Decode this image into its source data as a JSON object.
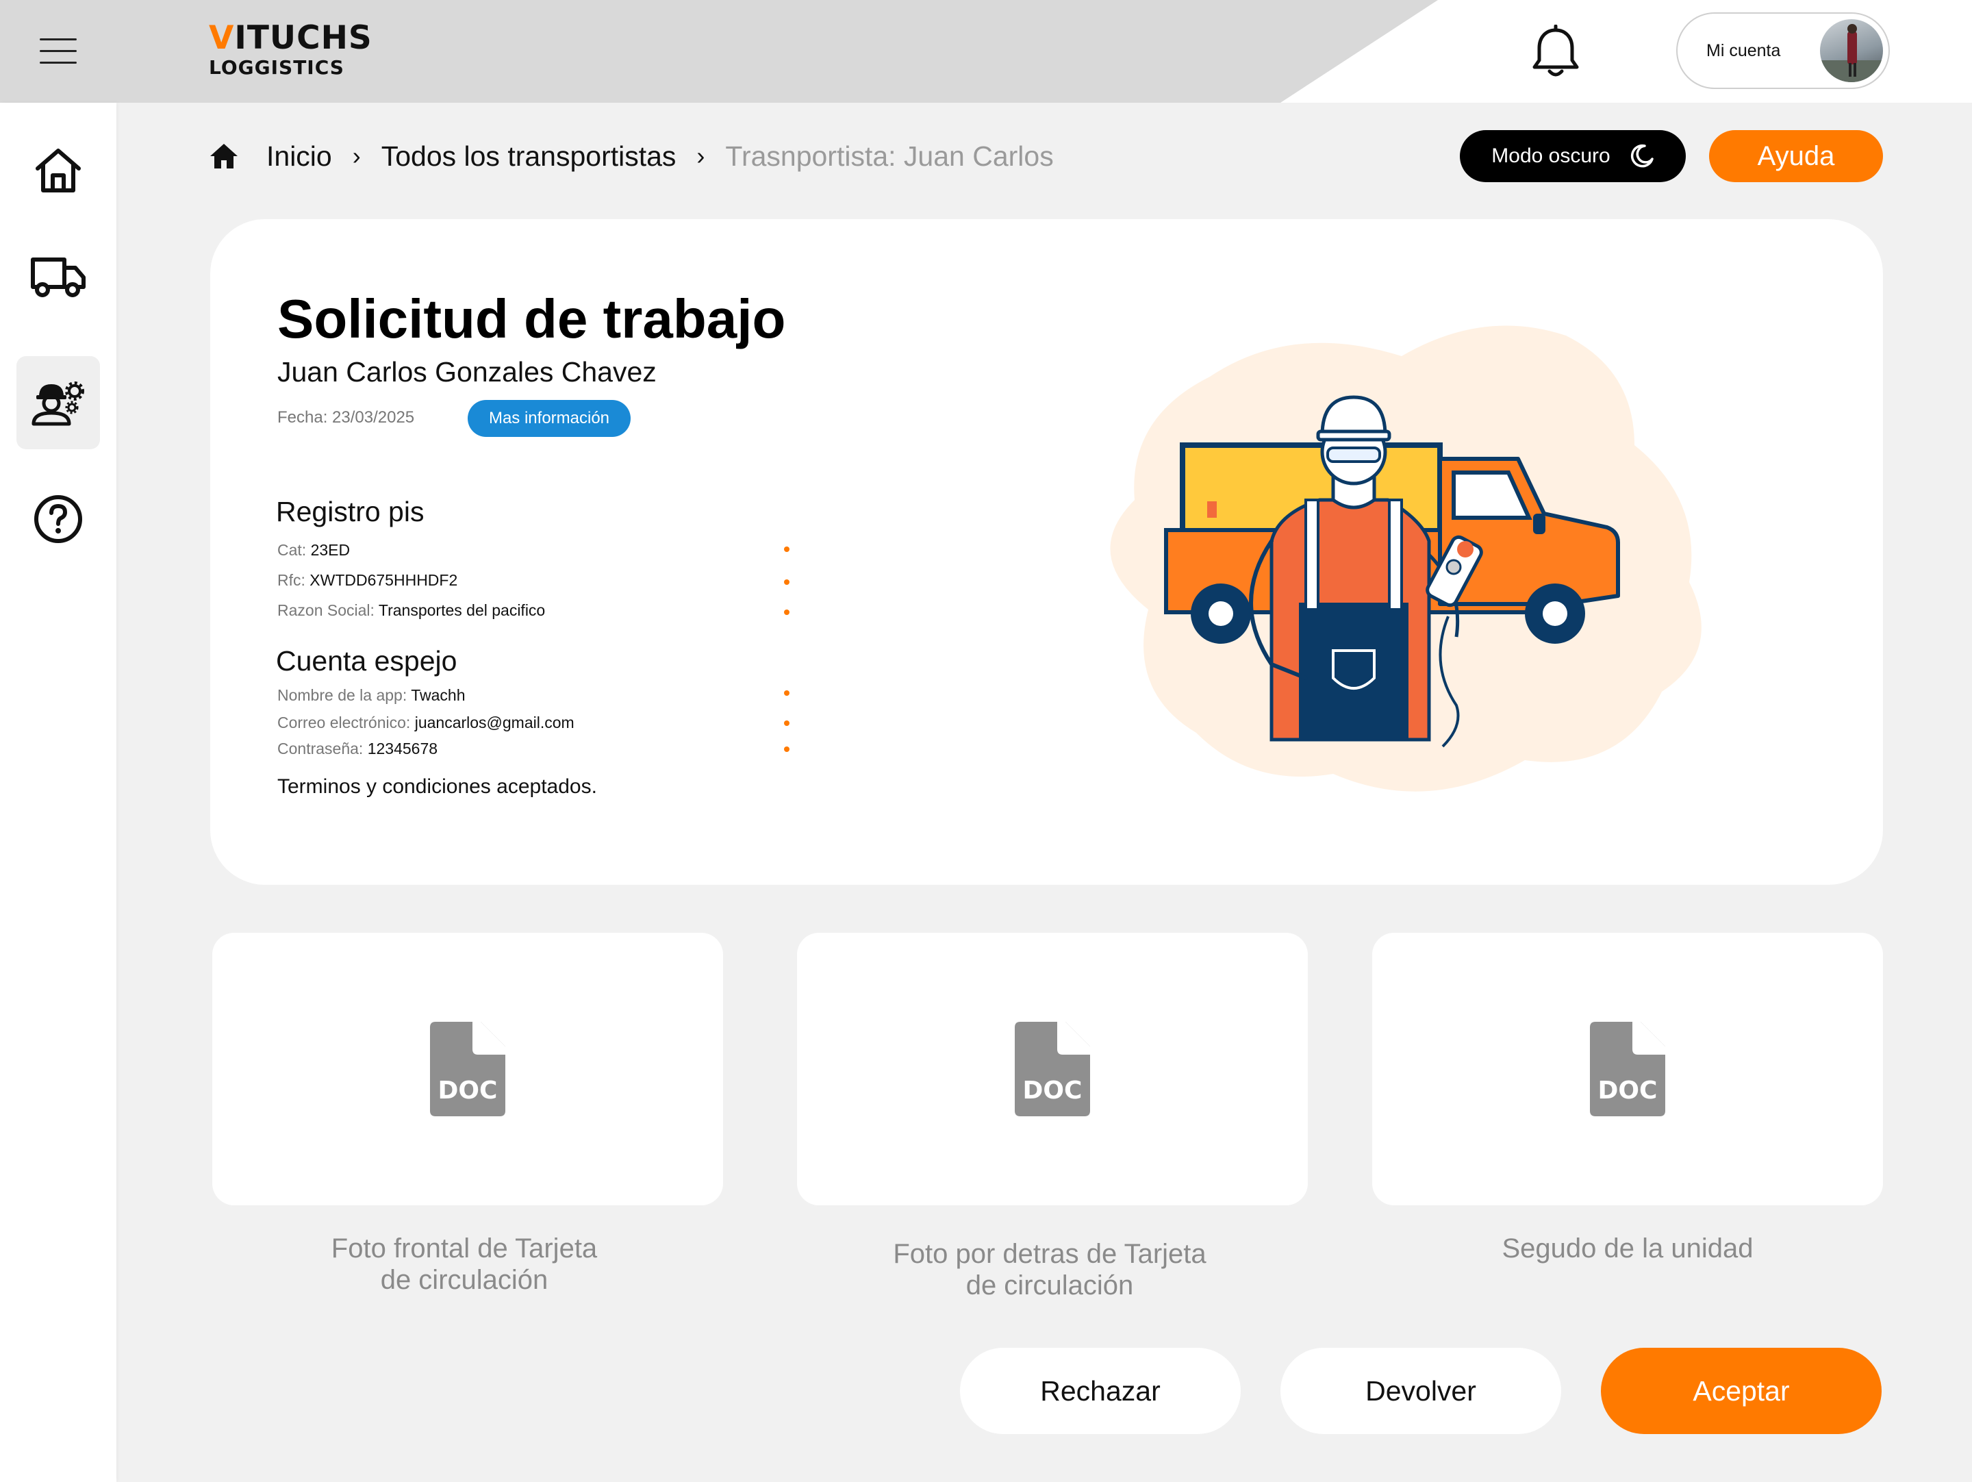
{
  "brand": {
    "logo_accent": "V",
    "logo_rest": "ITUCHS",
    "logo_sub": "LOGGISTICS",
    "accent_color": "#ff7a00"
  },
  "header": {
    "account_label": "Mi cuenta",
    "icons": [
      "menu-icon",
      "bell-icon",
      "avatar"
    ]
  },
  "sidebar": {
    "items": [
      {
        "name": "home",
        "icon": "home-icon",
        "active": false
      },
      {
        "name": "trucks",
        "icon": "truck-icon",
        "active": false
      },
      {
        "name": "workers",
        "icon": "worker-gear-icon",
        "active": true
      },
      {
        "name": "help",
        "icon": "help-circle-icon",
        "active": false
      }
    ]
  },
  "breadcrumb": {
    "home": "Inicio",
    "list": "Todos los transportistas",
    "current": "Trasnportista: Juan Carlos"
  },
  "toolbar": {
    "dark_mode": "Modo oscuro",
    "help": "Ayuda"
  },
  "request": {
    "title": "Solicitud de trabajo",
    "name": "Juan Carlos Gonzales Chavez",
    "date": "Fecha: 23/03/2025",
    "more_info": "Mas información",
    "registro": {
      "title": "Registro pis",
      "fields": [
        {
          "key": "Cat:",
          "value": "23ED"
        },
        {
          "key": "Rfc:",
          "value": "XWTDD675HHHDF2"
        },
        {
          "key": "Razon Social:",
          "value": "Transportes del pacifico"
        }
      ]
    },
    "cuenta": {
      "title": "Cuenta espejo",
      "fields": [
        {
          "key": "Nombre de la app:",
          "value": "Twachh"
        },
        {
          "key": "Correo electrónico:",
          "value": "juancarlos@gmail.com"
        },
        {
          "key": "Contraseña:",
          "value": "12345678"
        }
      ]
    },
    "terms": "Terminos y condiciones aceptados."
  },
  "documents": [
    {
      "label": "DOC",
      "caption_line1": "Foto frontal de Tarjeta",
      "caption_line2": "de circulación"
    },
    {
      "label": "DOC",
      "caption_line1": "Foto por detras de Tarjeta",
      "caption_line2": "de circulación"
    },
    {
      "label": "DOC",
      "caption_line1": "Segudo de la unidad",
      "caption_line2": ""
    }
  ],
  "actions": {
    "reject": "Rechazar",
    "return": "Devolver",
    "accept": "Aceptar"
  }
}
